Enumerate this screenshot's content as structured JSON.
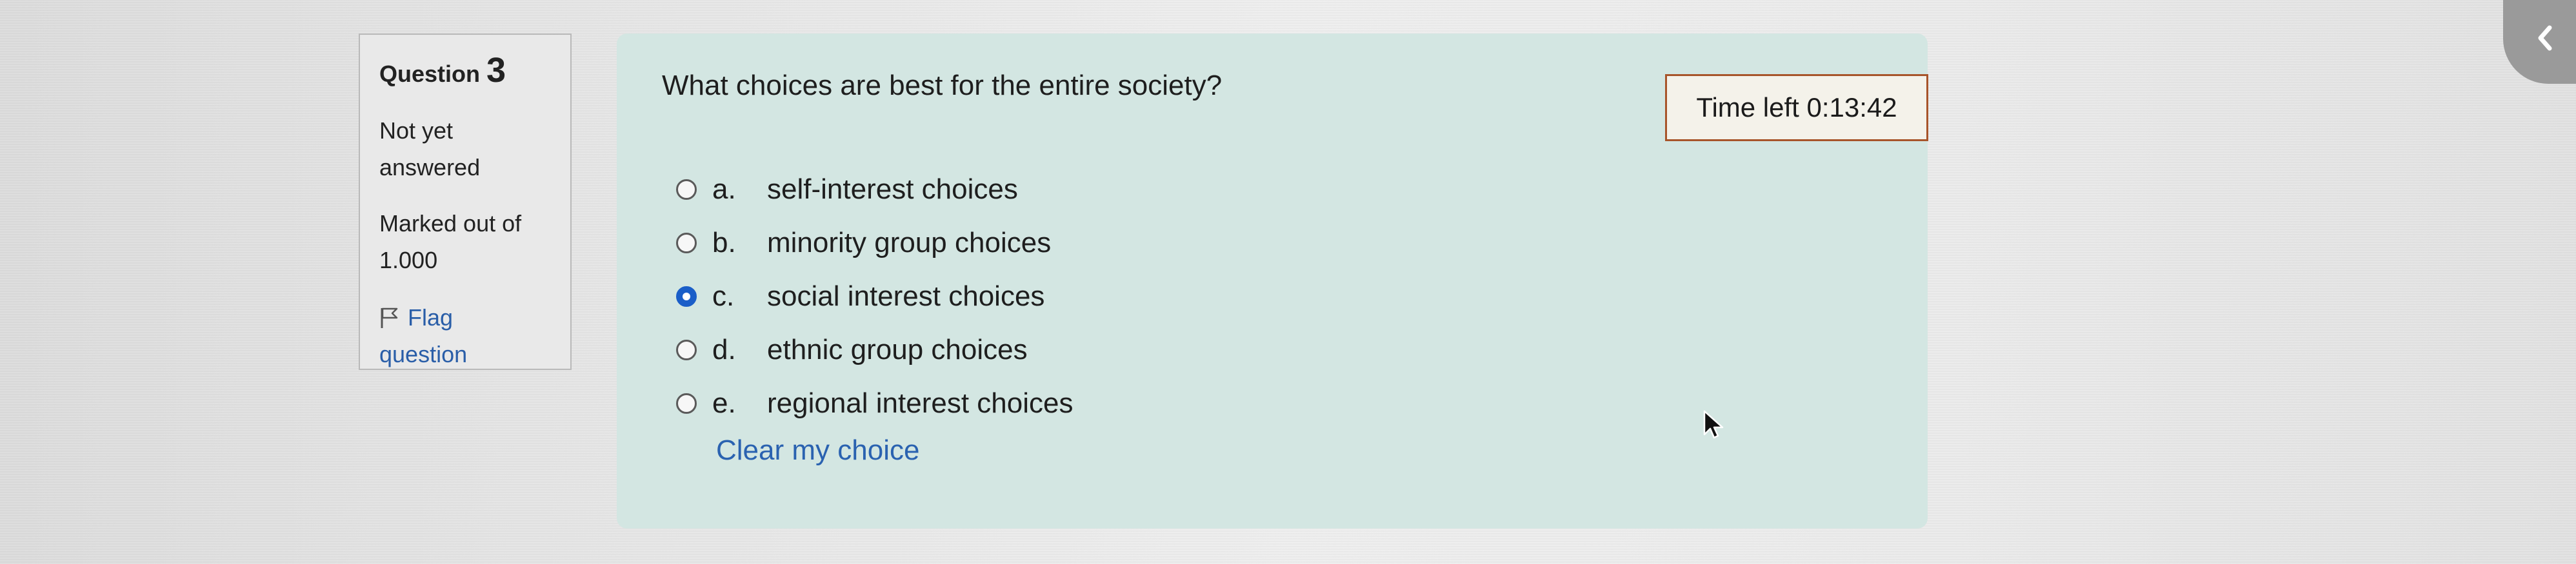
{
  "question_info": {
    "label": "Question",
    "number": "3",
    "state_line1": "Not yet",
    "state_line2": "answered",
    "marks_line1": "Marked out of",
    "marks_line2": "1.000",
    "flag_line1": "Flag",
    "flag_line2": "question"
  },
  "question": {
    "text": "What choices are best for the entire society?",
    "timer": "Time left 0:13:42",
    "options": [
      {
        "letter": "a.",
        "text": "self-interest choices",
        "checked": false
      },
      {
        "letter": "b.",
        "text": "minority group choices",
        "checked": false
      },
      {
        "letter": "c.",
        "text": "social interest choices",
        "checked": true
      },
      {
        "letter": "d.",
        "text": "ethnic group choices",
        "checked": false
      },
      {
        "letter": "e.",
        "text": "regional interest choices",
        "checked": false
      }
    ],
    "clear_label": "Clear my choice"
  },
  "colors": {
    "content_bg": "#d3e6e2",
    "link": "#2a62b0",
    "radio_checked": "#1a5ec8",
    "timer_border": "#a7542a"
  },
  "icons": {
    "flag": "flag-icon",
    "collapse": "chevron-left-icon",
    "cursor": "mouse-pointer-icon"
  }
}
